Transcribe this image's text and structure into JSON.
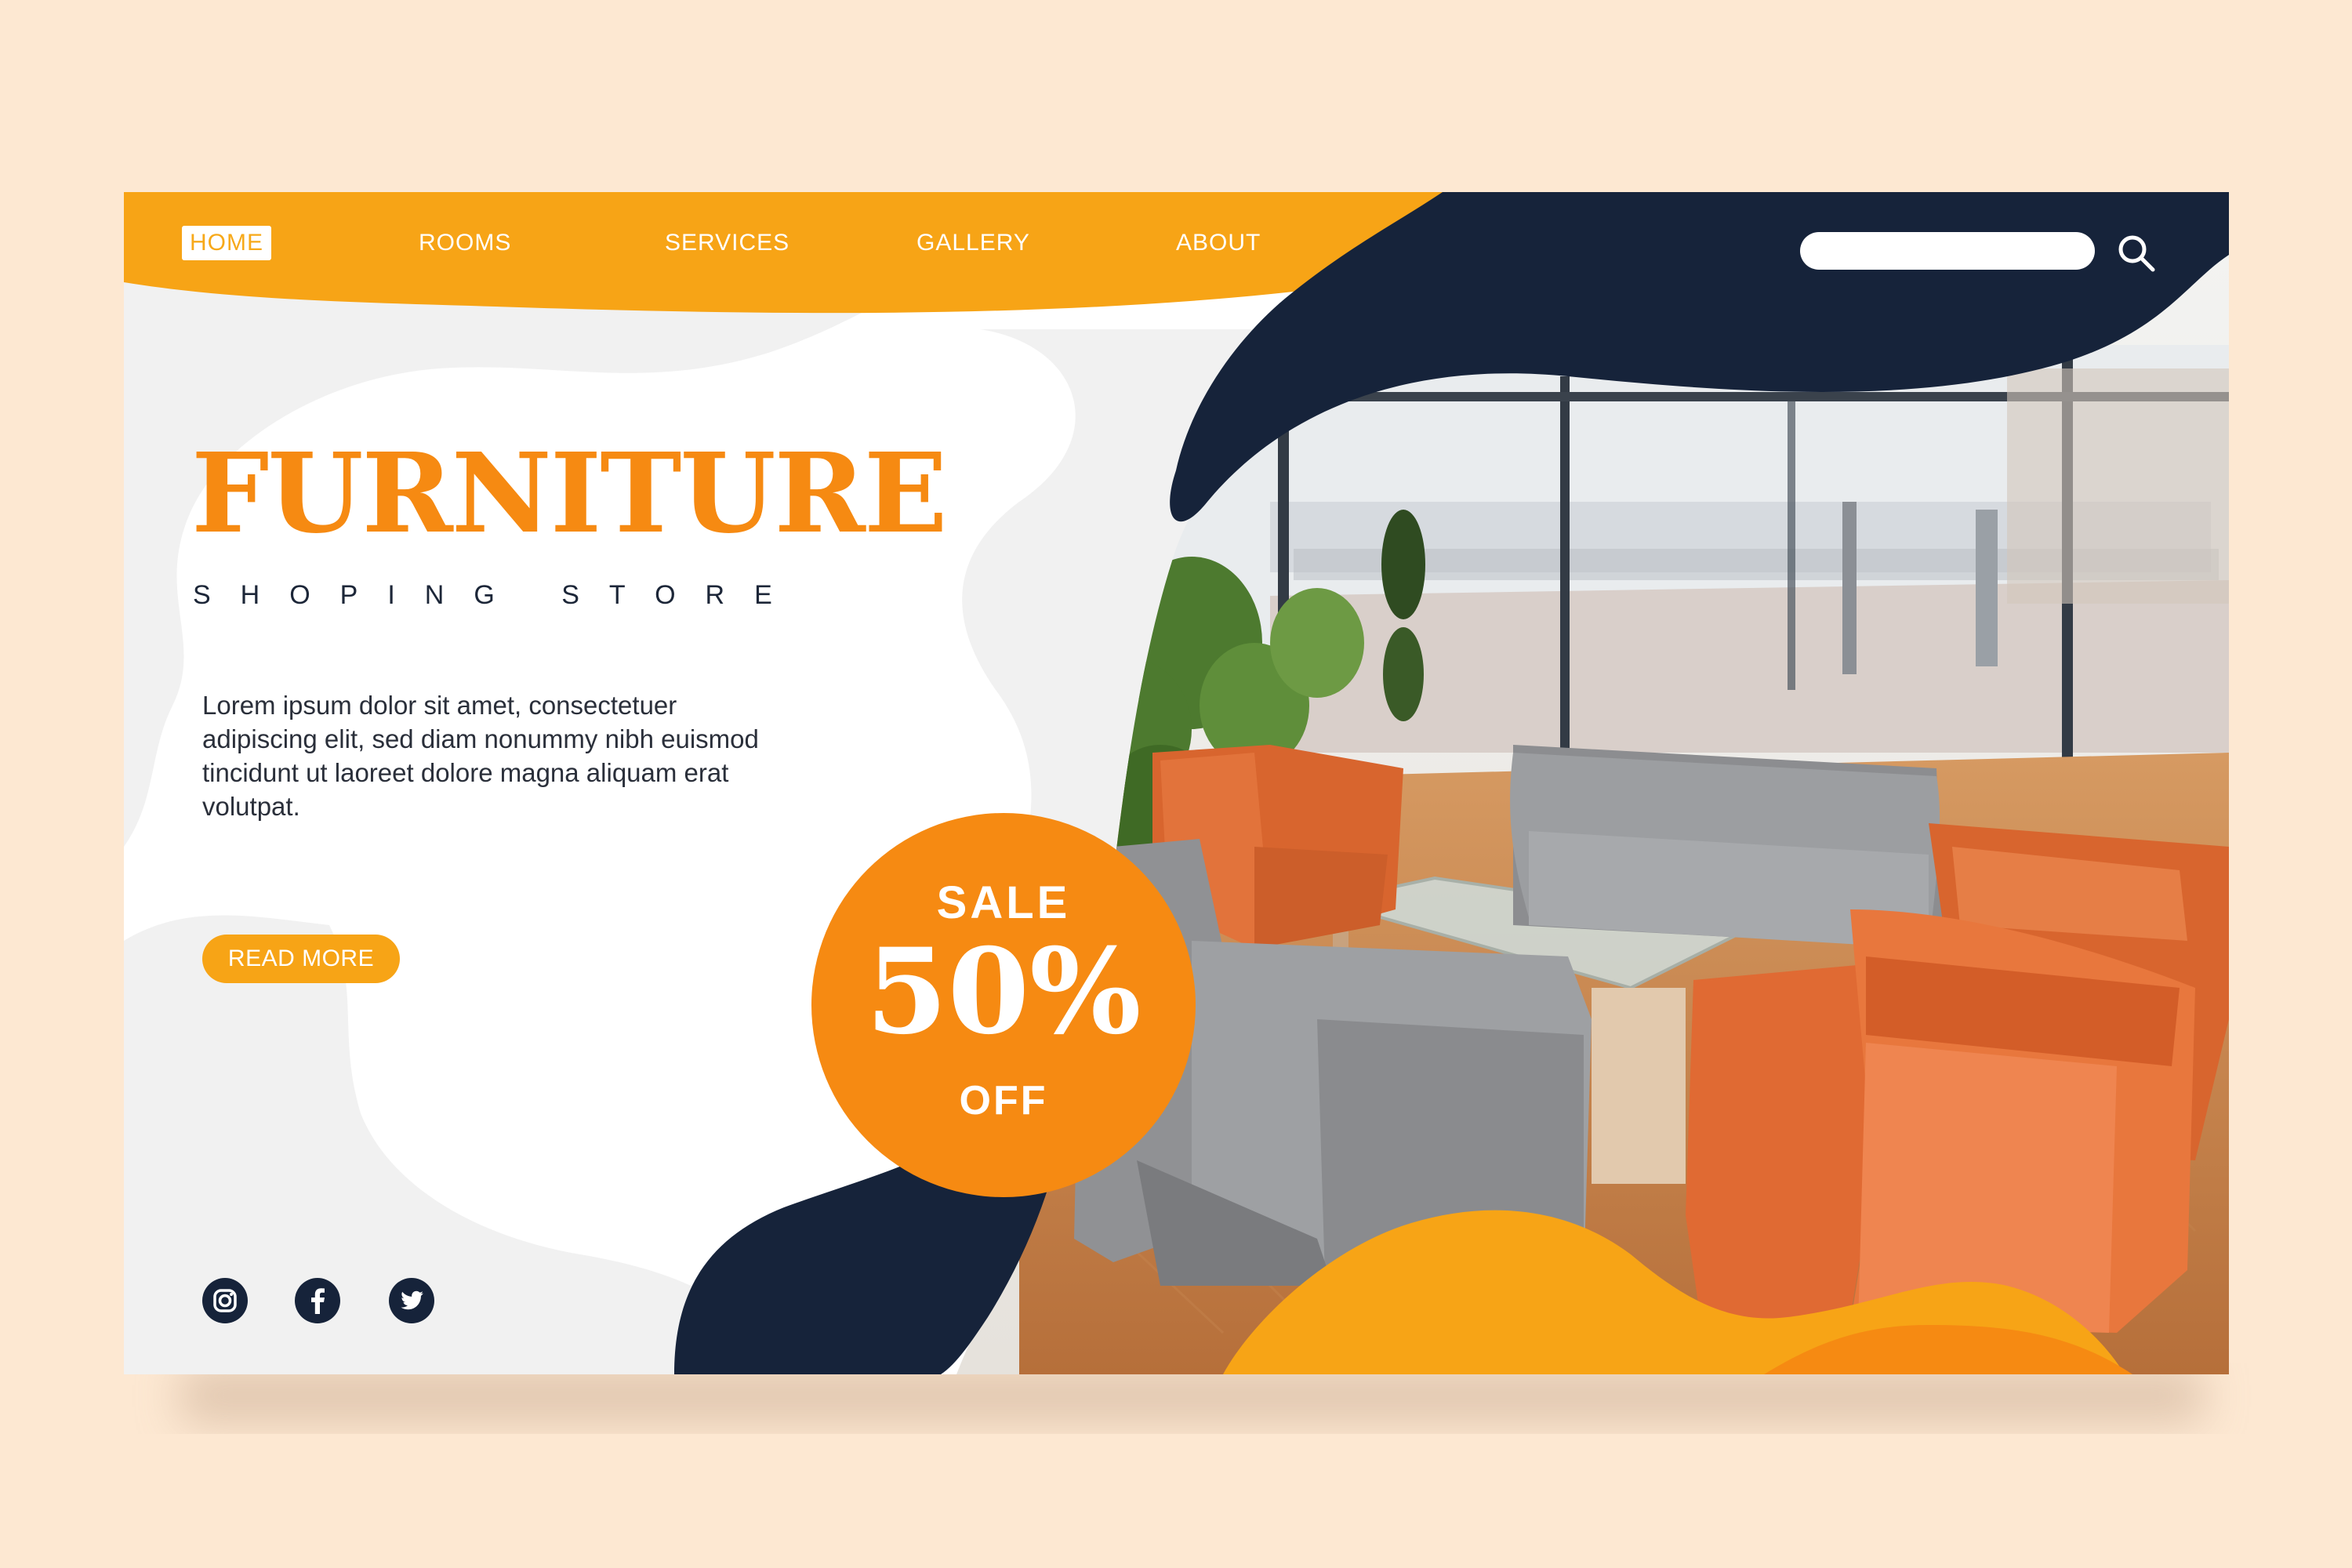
{
  "nav": {
    "items": [
      "HOME",
      "ROOMS",
      "SERVICES",
      "GALLERY",
      "ABOUT"
    ],
    "active": "HOME"
  },
  "search": {
    "value": "",
    "icon": "search-icon"
  },
  "hero": {
    "title": "FURNITURE",
    "subtitle": "SHOPING STORE",
    "body": "Lorem ipsum dolor sit amet, consectetuer adipiscing elit, sed diam nonummy nibh euismod tincidunt ut laoreet dolore magna aliquam erat volutpat.",
    "cta_label": "READ MORE"
  },
  "sale_badge": {
    "line1": "SALE",
    "value": "50%",
    "line2": "OFF"
  },
  "social": [
    "instagram-icon",
    "facebook-icon",
    "twitter-icon"
  ],
  "colors": {
    "background": "#fde8d2",
    "accent_orange": "#f7a416",
    "title_orange": "#f68a12",
    "navy": "#16233a",
    "light_gray": "#f1f1f1",
    "white": "#ffffff"
  }
}
